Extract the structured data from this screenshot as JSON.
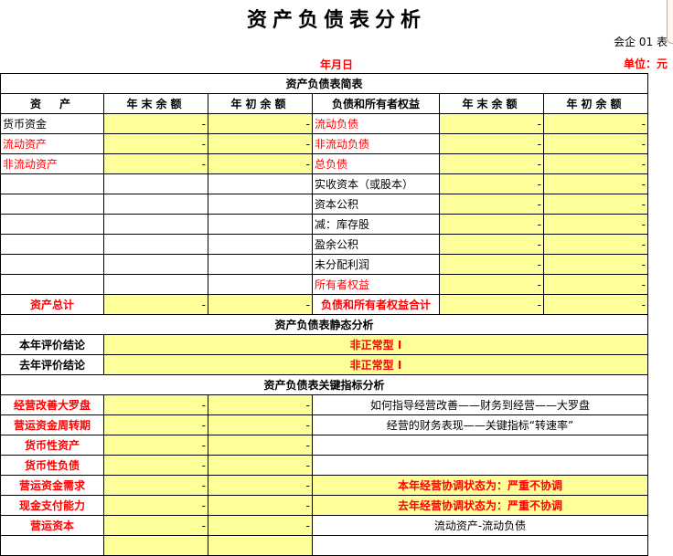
{
  "title": "资产负债表分析",
  "form_code": "会企 01 表",
  "date": "年月日",
  "unit": "单位：元",
  "summary": {
    "header": "资产负债表简表",
    "columns": [
      "资　产",
      "年末余额",
      "年初余额",
      "负债和所有者权益",
      "年末余额",
      "年初余额"
    ],
    "rows": [
      {
        "left": "货币资金",
        "left_red": false,
        "right": "流动负债",
        "right_red": true,
        "vals": [
          "-",
          "-",
          "-",
          "-"
        ]
      },
      {
        "left": "流动资产",
        "left_red": true,
        "right": "非流动负债",
        "right_red": true,
        "vals": [
          "-",
          "-",
          "-",
          "-"
        ]
      },
      {
        "left": "非流动资产",
        "left_red": true,
        "right": "总负债",
        "right_red": true,
        "vals": [
          "-",
          "-",
          "-",
          "-"
        ]
      },
      {
        "left": "",
        "right": "实收资本（或股本）",
        "vals": [
          "",
          "",
          "-",
          "-"
        ]
      },
      {
        "left": "",
        "right": "资本公积",
        "vals": [
          "",
          "",
          "-",
          "-"
        ]
      },
      {
        "left": "",
        "right": "减：库存股",
        "vals": [
          "",
          "",
          "-",
          "-"
        ]
      },
      {
        "left": "",
        "right": "盈余公积",
        "vals": [
          "",
          "",
          "-",
          "-"
        ]
      },
      {
        "left": "",
        "right": "未分配利润",
        "vals": [
          "",
          "",
          "-",
          "-"
        ]
      },
      {
        "left": "",
        "right": "所有者权益",
        "right_red": true,
        "vals": [
          "",
          "",
          "-",
          "-"
        ]
      }
    ],
    "total": {
      "left": "资产总计",
      "right": "负债和所有者权益合计",
      "vals": [
        "-",
        "-",
        "-",
        "-"
      ]
    }
  },
  "static": {
    "header": "资产负债表静态分析",
    "rows": [
      {
        "label": "本年评价结论",
        "value": "非正常型 I"
      },
      {
        "label": "去年评价结论",
        "value": "非正常型 I"
      }
    ]
  },
  "key": {
    "header": "资产负债表关键指标分析",
    "rows": [
      {
        "label": "经营改善大罗盘",
        "vals": [
          "-",
          "-"
        ],
        "note": "如何指导经营改善——财务到经营——大罗盘",
        "note_style": "plain"
      },
      {
        "label": "营运资金周转期",
        "vals": [
          "-",
          "-"
        ],
        "note": "经营的财务表现——关键指标“转速率”",
        "note_style": "plain"
      },
      {
        "label": "货币性资产",
        "vals": [
          "-",
          "-"
        ],
        "note": "",
        "note_style": "plain"
      },
      {
        "label": "货币性负债",
        "vals": [
          "-",
          "-"
        ],
        "note": "",
        "note_style": "plain"
      },
      {
        "label": "营运资金需求",
        "vals": [
          "-",
          "-"
        ],
        "note": "本年经营协调状态为：严重不协调",
        "note_style": "alert"
      },
      {
        "label": "现金支付能力",
        "vals": [
          "-",
          "-"
        ],
        "note": "去年经营协调状态为：严重不协调",
        "note_style": "alert"
      },
      {
        "label": "营运资本",
        "vals": [
          "-",
          "-"
        ],
        "note": "流动资产-流动负债",
        "note_style": "plain"
      },
      {
        "label": "",
        "vals": [
          "",
          ""
        ],
        "note": "",
        "note_style": "plain"
      }
    ]
  }
}
